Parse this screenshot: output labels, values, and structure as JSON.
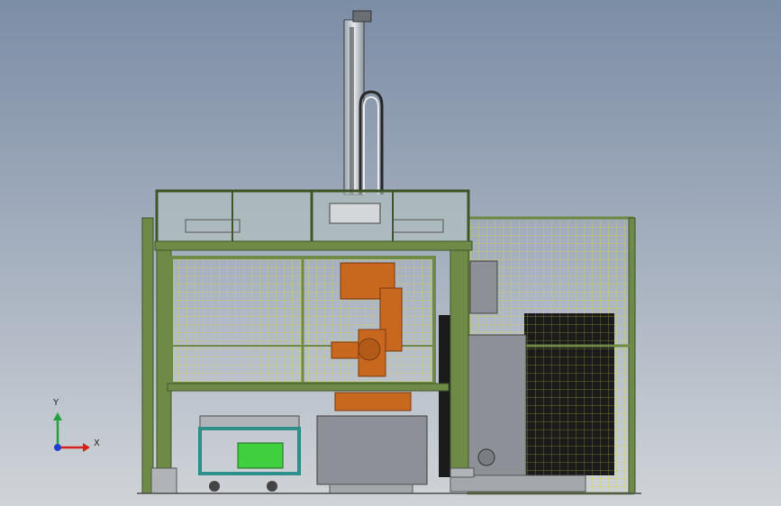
{
  "viewport": {
    "background_top": "#7c8da6",
    "background_bottom": "#d0d4d8"
  },
  "colors": {
    "frame_green": "#6f8a47",
    "frame_green_dark": "#3f5428",
    "mesh_yellow": "#d6d04a",
    "robot_orange": "#c8681e",
    "robot_orange_dark": "#7a3a10",
    "gray_panel": "#8d9096",
    "gray_dark": "#5c5f63",
    "cart_teal": "#2f8f8a",
    "motor_green": "#3fcf3f",
    "black_panel": "#1b1b1b"
  },
  "axis_triad": {
    "x_label": "X",
    "y_label": "Y",
    "x_color": "#d8201c",
    "y_color": "#20a23a",
    "origin_color": "#2040d0"
  }
}
